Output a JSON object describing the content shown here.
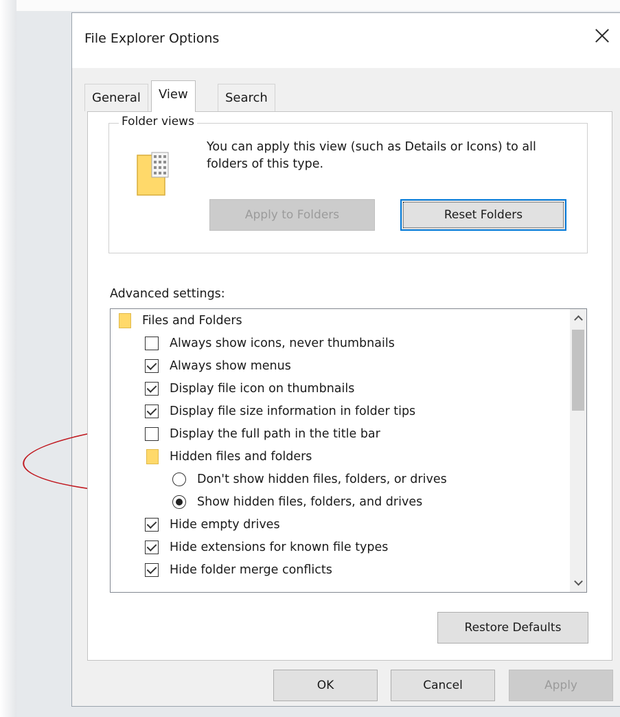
{
  "window": {
    "title": "File Explorer Options"
  },
  "tabs": [
    {
      "label": "General",
      "active": false
    },
    {
      "label": "View",
      "active": true
    },
    {
      "label": "Search",
      "active": false
    }
  ],
  "folder_views": {
    "legend": "Folder views",
    "description": "You can apply this view (such as Details or Icons) to all folders of this type.",
    "apply_button": "Apply to Folders",
    "reset_button": "Reset Folders"
  },
  "advanced": {
    "label": "Advanced settings:",
    "items": [
      {
        "type": "folder",
        "label": "Files and Folders"
      },
      {
        "type": "checkbox",
        "label": "Always show icons, never thumbnails",
        "checked": false
      },
      {
        "type": "checkbox",
        "label": "Always show menus",
        "checked": true
      },
      {
        "type": "checkbox",
        "label": "Display file icon on thumbnails",
        "checked": true
      },
      {
        "type": "checkbox",
        "label": "Display file size information in folder tips",
        "checked": true
      },
      {
        "type": "checkbox",
        "label": "Display the full path in the title bar",
        "checked": false
      },
      {
        "type": "folder",
        "label": "Hidden files and folders"
      },
      {
        "type": "radio",
        "label": "Don't show hidden files, folders, or drives",
        "checked": false
      },
      {
        "type": "radio",
        "label": "Show hidden files, folders, and drives",
        "checked": true
      },
      {
        "type": "checkbox",
        "label": "Hide empty drives",
        "checked": true
      },
      {
        "type": "checkbox",
        "label": "Hide extensions for known file types",
        "checked": true
      },
      {
        "type": "checkbox",
        "label": "Hide folder merge conflicts",
        "checked": true
      }
    ]
  },
  "buttons": {
    "restore_defaults": "Restore Defaults",
    "ok": "OK",
    "cancel": "Cancel",
    "apply": "Apply"
  },
  "icons": {
    "close": "close-icon",
    "folder": "folder-icon",
    "scroll_up": "chevron-up-icon",
    "scroll_down": "chevron-down-icon"
  },
  "colors": {
    "annotation": "#c0181f",
    "focus": "#0078d7",
    "folder": "#ffd96a"
  }
}
